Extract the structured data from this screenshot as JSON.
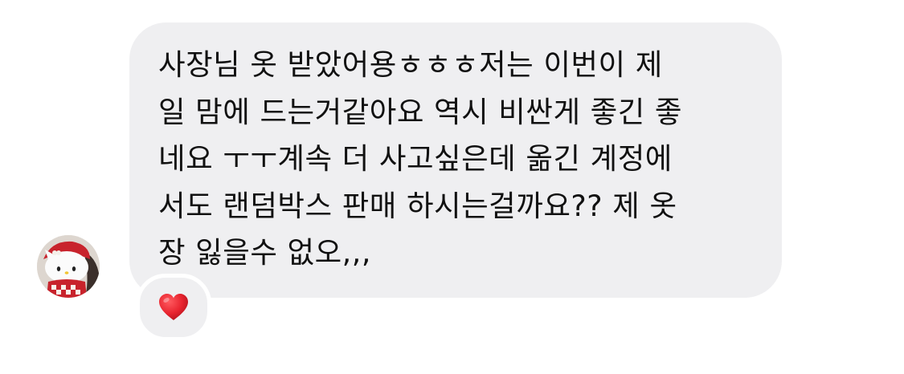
{
  "message": {
    "sender_avatar_icon": "hello-kitty-avatar-icon",
    "text": "사장님 옷 받았어용ㅎㅎㅎ저는 이번이 제\n일 맘에 드는거같아요 역시 비싼게 좋긴 좋\n네요 ㅜㅜ계속 더 사고싶은데 옮긴 계정에\n서도 랜덤박스 판매 하시는걸까요?? 제 옷\n장 잃을수 없오,,,",
    "reaction_icon": "red-heart-icon"
  },
  "colors": {
    "bubble_background": "#efeff1",
    "text": "#111111",
    "heart": "#e8242f"
  }
}
